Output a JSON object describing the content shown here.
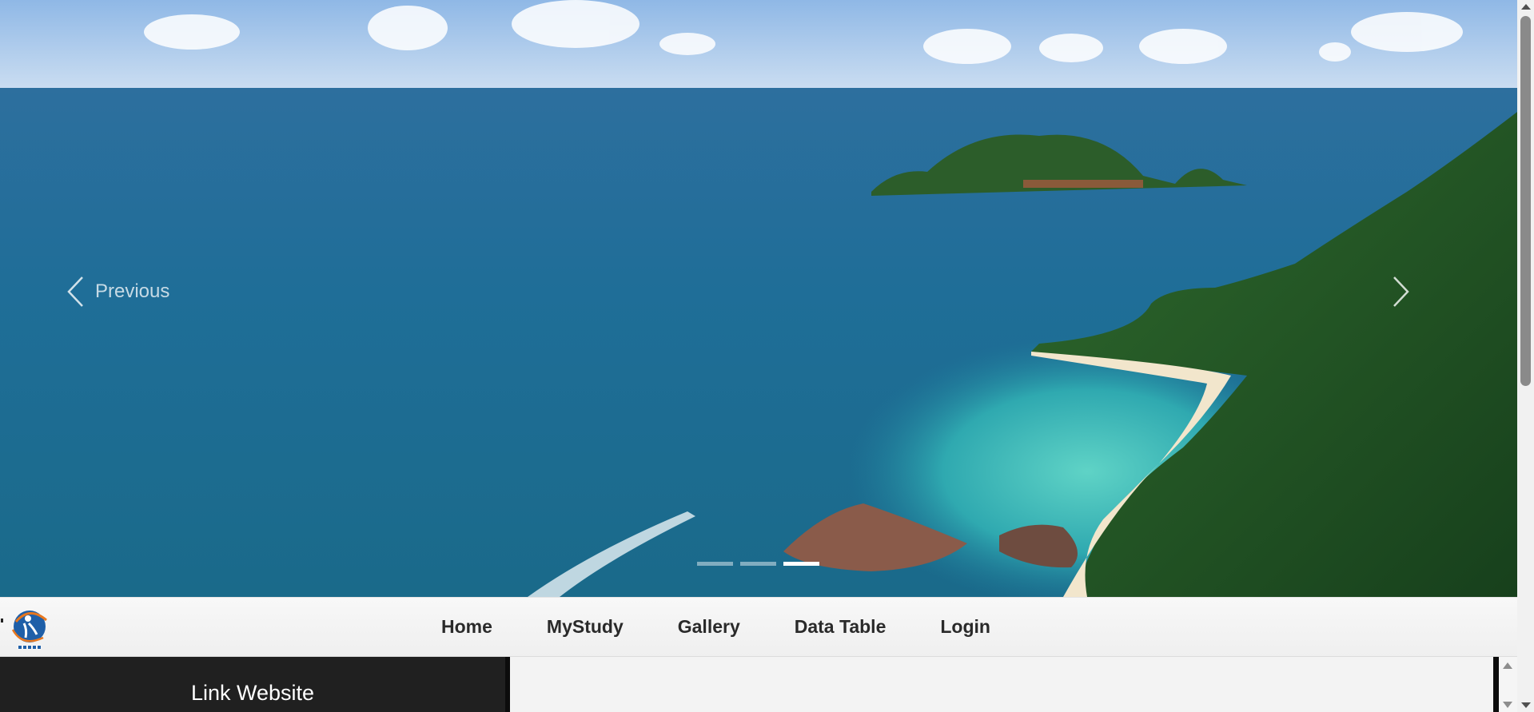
{
  "carousel": {
    "prev_label": "Previous",
    "slide_count": 3,
    "active_slide": 3,
    "slide_image": "aerial tropical island coastline photo"
  },
  "navbar": {
    "logo_icon": "stt-nf-logo-icon",
    "items": [
      {
        "label": "Home"
      },
      {
        "label": "MyStudy"
      },
      {
        "label": "Gallery"
      },
      {
        "label": "Data Table"
      },
      {
        "label": "Login"
      }
    ]
  },
  "sidebar": {
    "title": "Link Website"
  },
  "colors": {
    "navbar_bg": "#f5f5f5",
    "sidebar_bg": "#202020",
    "nav_text": "#2a2a2a"
  }
}
